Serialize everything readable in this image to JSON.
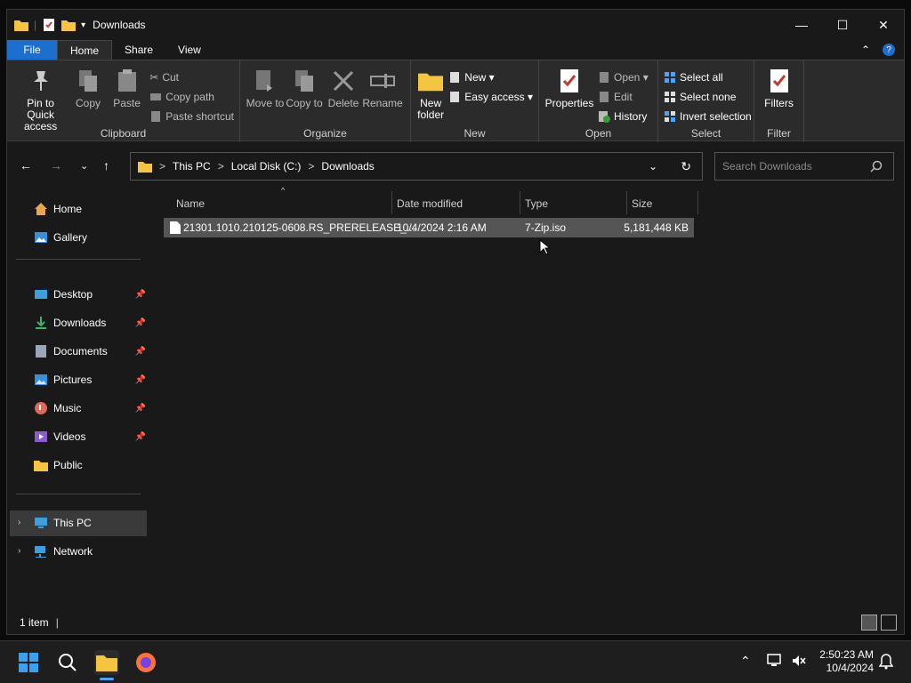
{
  "window": {
    "title": "Downloads",
    "controls": {
      "minimize": "—",
      "maximize": "☐",
      "close": "✕"
    }
  },
  "ribbon_tabs": {
    "file": "File",
    "home": "Home",
    "share": "Share",
    "view": "View",
    "collapse": "⌃",
    "help": "?"
  },
  "ribbon": {
    "clipboard": {
      "pin": "Pin to Quick access",
      "copy": "Copy",
      "paste": "Paste",
      "cut": "Cut",
      "copy_path": "Copy path",
      "paste_shortcut": "Paste shortcut",
      "label": "Clipboard"
    },
    "organize": {
      "move_to": "Move to",
      "copy_to": "Copy to",
      "delete": "Delete",
      "rename": "Rename",
      "label": "Organize"
    },
    "new": {
      "new_folder": "New folder",
      "new_item": "New ▾",
      "easy_access": "Easy access ▾",
      "label": "New"
    },
    "open": {
      "properties": "Properties",
      "open": "Open ▾",
      "edit": "Edit",
      "history": "History",
      "label": "Open"
    },
    "select": {
      "select_all": "Select all",
      "select_none": "Select none",
      "invert": "Invert selection",
      "label": "Select"
    },
    "filter": {
      "filters": "Filters",
      "label": "Filter"
    }
  },
  "address": {
    "crumbs": [
      "This PC",
      "Local Disk (C:)",
      "Downloads"
    ],
    "separator": ">",
    "search_placeholder": "Search Downloads"
  },
  "sidebar": {
    "home": "Home",
    "gallery": "Gallery",
    "desktop": "Desktop",
    "downloads": "Downloads",
    "documents": "Documents",
    "pictures": "Pictures",
    "music": "Music",
    "videos": "Videos",
    "public": "Public",
    "this_pc": "This PC",
    "network": "Network"
  },
  "columns": {
    "name": "Name",
    "date": "Date modified",
    "type": "Type",
    "size": "Size"
  },
  "files": [
    {
      "name": "21301.1010.210125-0608.RS_PRERELEASE_...",
      "date": "10/4/2024 2:16 AM",
      "type": "7-Zip.iso",
      "size": "5,181,448 KB"
    }
  ],
  "status": {
    "count": "1 item"
  },
  "taskbar": {
    "time": "2:50:23 AM",
    "date": "10/4/2024"
  },
  "colors": {
    "accent": "#1c6fcf",
    "folder": "#f5c542",
    "window_bg": "#191919",
    "ribbon_bg": "#2b2b2b"
  }
}
